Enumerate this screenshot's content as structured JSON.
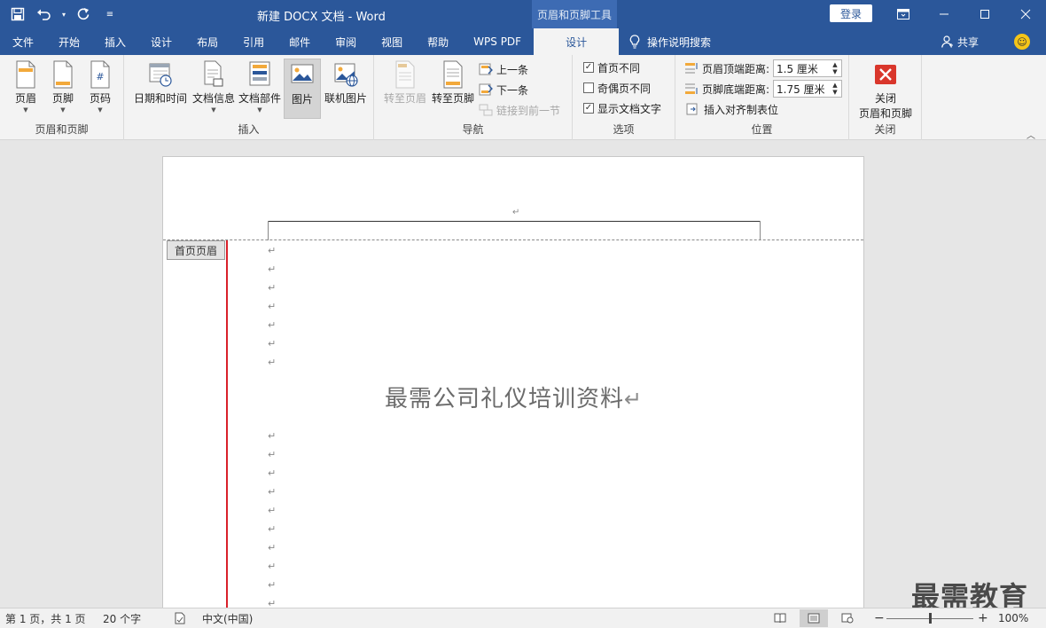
{
  "window": {
    "title": "新建 DOCX 文档  -  Word",
    "context_tools": "页眉和页脚工具",
    "login": "登录"
  },
  "tabs": [
    {
      "label": "文件"
    },
    {
      "label": "开始"
    },
    {
      "label": "插入"
    },
    {
      "label": "设计"
    },
    {
      "label": "布局"
    },
    {
      "label": "引用"
    },
    {
      "label": "邮件"
    },
    {
      "label": "审阅"
    },
    {
      "label": "视图"
    },
    {
      "label": "帮助"
    },
    {
      "label": "WPS PDF"
    },
    {
      "label": "设计"
    }
  ],
  "tellme": "操作说明搜索",
  "share": "共享",
  "ribbon": {
    "hf_group": {
      "label": "页眉和页脚",
      "header": "页眉",
      "footer": "页脚",
      "page_number": "页码"
    },
    "insert_group": {
      "label": "插入",
      "date_time": "日期和时间",
      "doc_info": "文档信息",
      "quick_parts": "文档部件",
      "picture": "图片",
      "online_picture": "联机图片"
    },
    "nav_group": {
      "label": "导航",
      "goto_header": "转至页眉",
      "goto_footer": "转至页脚",
      "previous": "上一条",
      "next": "下一条",
      "link_previous": "链接到前一节"
    },
    "options_group": {
      "label": "选项",
      "different_first": {
        "label": "首页不同",
        "checked": true
      },
      "different_odd_even": {
        "label": "奇偶页不同",
        "checked": false
      },
      "show_doc_text": {
        "label": "显示文档文字",
        "checked": true
      }
    },
    "position_group": {
      "label": "位置",
      "header_top_label": "页眉顶端距离:",
      "header_top_value": "1.5 厘米",
      "footer_bottom_label": "页脚底端距离:",
      "footer_bottom_value": "1.75 厘米",
      "insert_align_tab": "插入对齐制表位"
    },
    "close_group": {
      "label": "关闭",
      "close_line1": "关闭",
      "close_line2": "页眉和页脚"
    }
  },
  "document": {
    "header_tag": "首页页眉",
    "paragraph_mark": "↵",
    "title": "最需公司礼仪培训资料"
  },
  "watermark": "最需教育",
  "status": {
    "page": "第 1 页，共 1 页",
    "words": "20 个字",
    "language": "中文(中国)",
    "zoom": "100%"
  },
  "colors": {
    "brand": "#2b579a",
    "close_red": "#d9362b",
    "margin_red": "#d9202a"
  }
}
